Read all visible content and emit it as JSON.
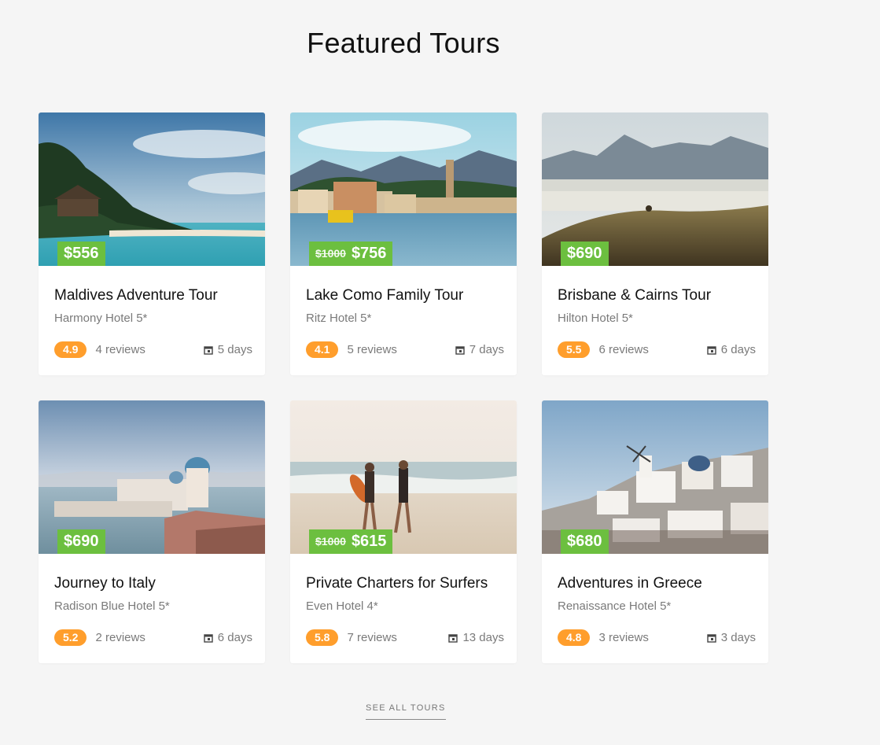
{
  "section": {
    "title": "Featured Tours",
    "see_all": "SEE ALL TOURS"
  },
  "colors": {
    "price_tag": "#6cbf3f",
    "rating_badge": "#ff9e2c",
    "background": "#f5f5f5"
  },
  "tours": [
    {
      "title": "Maldives Adventure Tour",
      "hotel": "Harmony Hotel 5*",
      "price": "$556",
      "old_price": "",
      "rating": "4.9",
      "reviews": "4 reviews",
      "duration": "5 days",
      "image": "tropical-beach-bungalows"
    },
    {
      "title": "Lake Como Family Tour",
      "hotel": "Ritz Hotel 5*",
      "price": "$756",
      "old_price": "$1000",
      "rating": "4.1",
      "reviews": "5 reviews",
      "duration": "7 days",
      "image": "lakeside-village"
    },
    {
      "title": "Brisbane & Cairns Tour",
      "hotel": "Hilton Hotel 5*",
      "price": "$690",
      "old_price": "",
      "rating": "5.5",
      "reviews": "6 reviews",
      "duration": "6 days",
      "image": "mountain-hills"
    },
    {
      "title": "Journey to Italy",
      "hotel": "Radison Blue Hotel 5*",
      "price": "$690",
      "old_price": "",
      "rating": "5.2",
      "reviews": "2 reviews",
      "duration": "6 days",
      "image": "venice-cityscape"
    },
    {
      "title": "Private Charters for Surfers",
      "hotel": "Even Hotel 4*",
      "price": "$615",
      "old_price": "$1000",
      "rating": "5.8",
      "reviews": "7 reviews",
      "duration": "13 days",
      "image": "surfers-on-beach"
    },
    {
      "title": "Adventures in Greece",
      "hotel": "Renaissance Hotel 5*",
      "price": "$680",
      "old_price": "",
      "rating": "4.8",
      "reviews": "3 reviews",
      "duration": "3 days",
      "image": "santorini-village"
    }
  ]
}
